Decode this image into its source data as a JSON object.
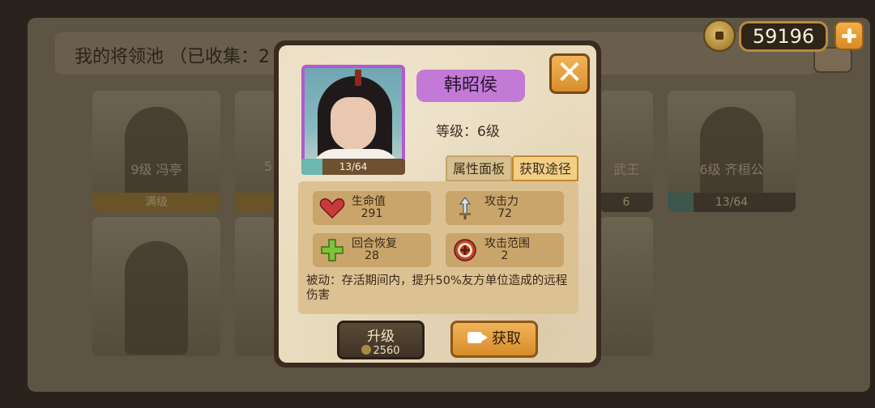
{
  "currency": {
    "coins": "59196"
  },
  "board": {
    "title": "我的将领池 （已收集：2",
    "cards_row1": [
      {
        "name": "9级 冯亭",
        "bar": "满级"
      },
      {
        "name": "5",
        "bar": ""
      },
      {
        "name": "武王",
        "bar": "6"
      },
      {
        "name": "6级 齐桓公",
        "bar": "13/64"
      }
    ]
  },
  "dialog": {
    "general_name": "韩昭侯",
    "level_text": "等级：6级",
    "progress_text": "13/64",
    "progress_fraction": 0.203,
    "tabs": {
      "attributes": "属性面板",
      "source": "获取途径"
    },
    "stats": {
      "hp": {
        "label": "生命值",
        "value": "291",
        "icon": "heart-icon"
      },
      "attack": {
        "label": "攻击力",
        "value": "72",
        "icon": "sword-icon"
      },
      "regen": {
        "label": "回合恢复",
        "value": "28",
        "icon": "plus-cross-icon"
      },
      "range": {
        "label": "攻击范围",
        "value": "2",
        "icon": "target-icon"
      }
    },
    "passive": "被动：存活期间内，提升50%友方单位造成的远程伤害",
    "upgrade": {
      "label": "升级",
      "cost": "2560"
    },
    "get": {
      "label": "获取"
    },
    "close_glyph": "✕"
  },
  "colors": {
    "name_badge": "#c27ad6",
    "avatar_border": "#b25ad1",
    "orange_button": "#e09a38",
    "progress_fill": "#6cb7b1"
  }
}
